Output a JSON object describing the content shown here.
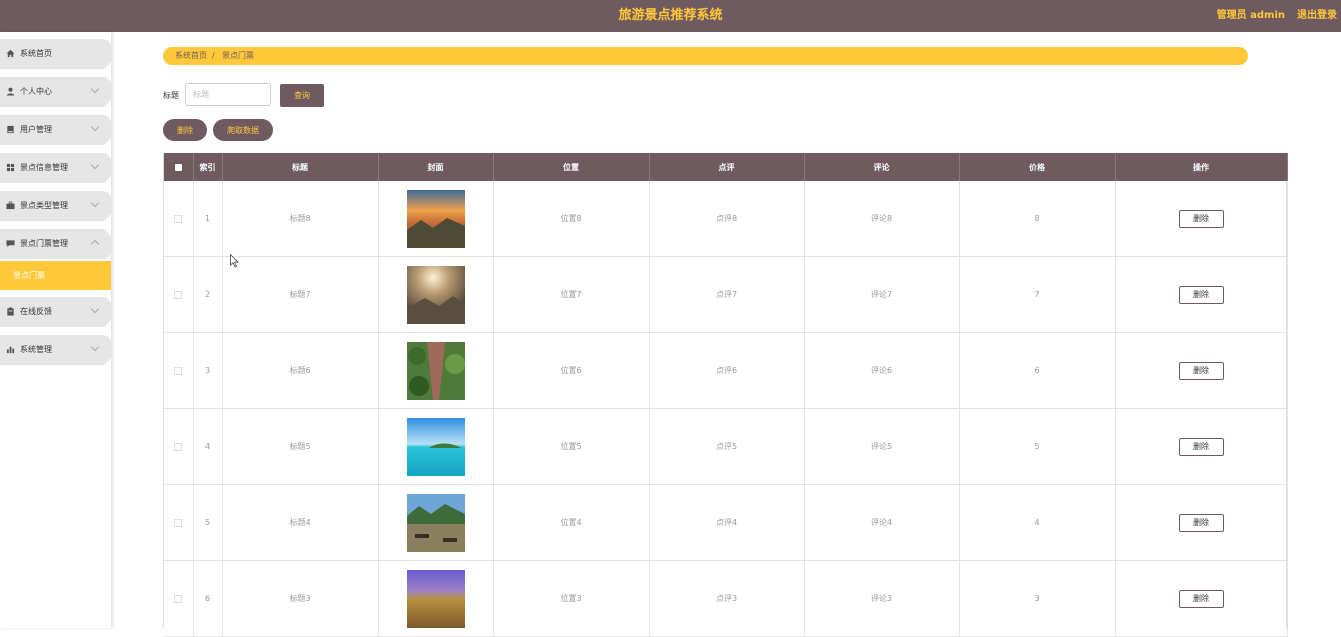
{
  "header": {
    "title": "旅游景点推荐系统",
    "user_label": "管理员 admin",
    "logout_label": "退出登录",
    "colors": {
      "bar": "#6f5b5f",
      "accent": "#ffc83a"
    }
  },
  "sidebar": {
    "items": [
      {
        "label": "系统首页",
        "icon": "home-icon"
      },
      {
        "label": "个人中心",
        "icon": "user-icon"
      },
      {
        "label": "用户管理",
        "icon": "book-icon"
      },
      {
        "label": "景点信息管理",
        "icon": "grid-icon"
      },
      {
        "label": "景点类型管理",
        "icon": "briefcase-icon"
      },
      {
        "label": "景点门票管理",
        "icon": "message-icon"
      },
      {
        "label": "在线反馈",
        "icon": "clipboard-icon"
      },
      {
        "label": "系统管理",
        "icon": "bar-chart-icon"
      }
    ],
    "submenu_active": "景点门票"
  },
  "breadcrumb": {
    "home": "系统首页",
    "separator": "/",
    "current": "景点门票"
  },
  "search": {
    "label": "标题",
    "placeholder": "标题",
    "value": "",
    "button": "查询"
  },
  "actions": {
    "delete": "删除",
    "crawl": "爬取数据"
  },
  "table": {
    "columns": [
      "索引",
      "标题",
      "封面",
      "位置",
      "点评",
      "评论",
      "价格",
      "操作"
    ],
    "rows": [
      {
        "index": "1",
        "title": "标题8",
        "location": "位置8",
        "review": "点评8",
        "comment": "评论8",
        "price": "8",
        "action": "删除"
      },
      {
        "index": "2",
        "title": "标题7",
        "location": "位置7",
        "review": "点评7",
        "comment": "评论7",
        "price": "7",
        "action": "删除"
      },
      {
        "index": "3",
        "title": "标题6",
        "location": "位置6",
        "review": "点评6",
        "comment": "评论6",
        "price": "6",
        "action": "删除"
      },
      {
        "index": "4",
        "title": "标题5",
        "location": "位置5",
        "review": "点评5",
        "comment": "评论5",
        "price": "5",
        "action": "删除"
      },
      {
        "index": "5",
        "title": "标题4",
        "location": "位置4",
        "review": "点评4",
        "comment": "评论4",
        "price": "4",
        "action": "删除"
      },
      {
        "index": "6",
        "title": "标题3",
        "location": "位置3",
        "review": "点评3",
        "comment": "评论3",
        "price": "3",
        "action": "删除"
      }
    ]
  }
}
